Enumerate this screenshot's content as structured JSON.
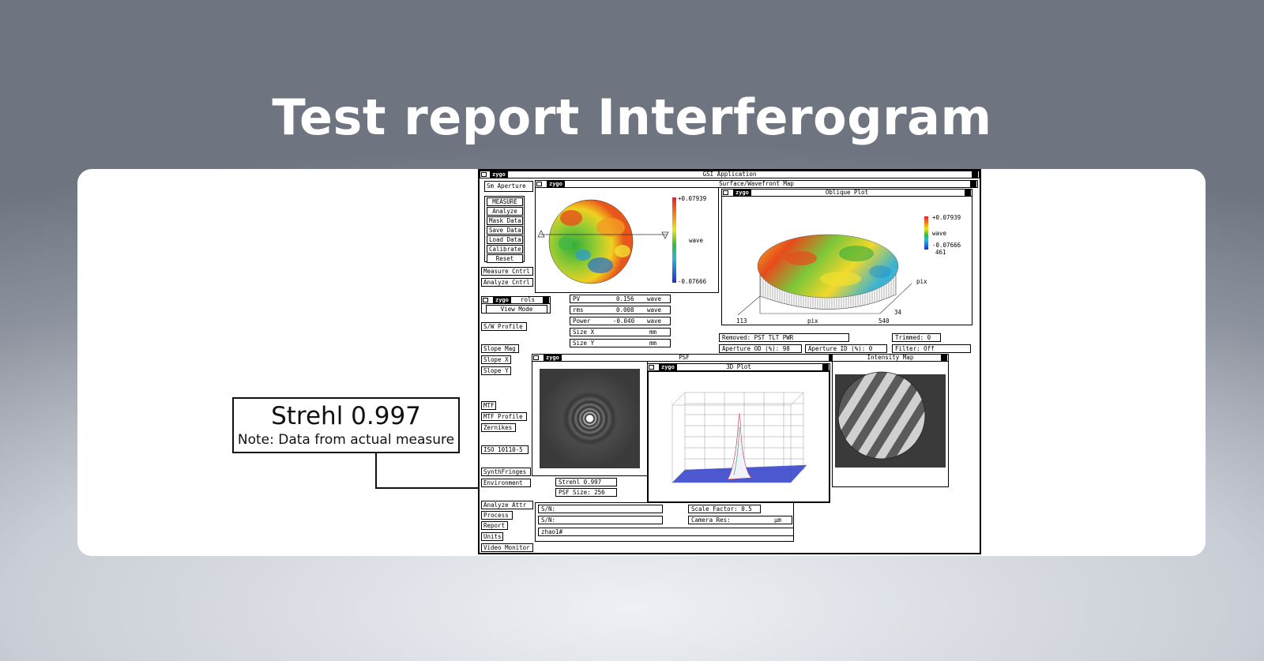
{
  "page": {
    "title": "Test report Interferogram"
  },
  "callout": {
    "strehl_label": "Strehl 0.997",
    "note": "Note: Data from actual measure"
  },
  "app": {
    "title": "GSI Application",
    "logo": "zygo",
    "left_panel": {
      "aperture": "Sm Aperture",
      "buttons": [
        "MEASURE",
        "Analyze",
        "Mask Data",
        "Save Data",
        "Load Data",
        "Calibrate",
        "Reset"
      ],
      "measure_cntrl": "Measure Cntrl",
      "analyze_cntrl": "Analyze Cntrl",
      "controls_title": "rols",
      "view_mode": "View Mode",
      "sw_profile": "S/W Profile",
      "slope_mag": "Slope Mag",
      "slope_x": "Slope X",
      "slope_y": "Slope Y",
      "mtf": "MTF",
      "mtf_profile": "MTF Profile",
      "zernikes": "Zernikes",
      "iso": "ISO 10110-5",
      "synth_fringes": "SynthFringes",
      "environment": "Environment",
      "analyze_attr": "Analyze Attr",
      "process": "Process",
      "report": "Report",
      "units": "Units",
      "video_monitor": "Video Monitor"
    },
    "surface_map": {
      "title": "Surface/Wavefront Map",
      "scale_max": "+0.07939",
      "scale_min": "-0.07666",
      "scale_unit": "wave"
    },
    "stats": [
      {
        "label": "PV",
        "value": "0.156",
        "unit": "wave"
      },
      {
        "label": "rms",
        "value": "0.008",
        "unit": "wave"
      },
      {
        "label": "Power",
        "value": "-0.040",
        "unit": "wave"
      },
      {
        "label": "Size X",
        "value": "",
        "unit": "mm"
      },
      {
        "label": "Size Y",
        "value": "",
        "unit": "mm"
      }
    ],
    "oblique": {
      "title": "Oblique Plot",
      "scale_max": "+0.07939",
      "scale_unit": "wave",
      "scale_min": "-0.07666",
      "y_max": "461",
      "axis_pix_right": "pix",
      "y_min": "34",
      "x_min": "113",
      "x_label": "pix",
      "x_max": "540"
    },
    "settings": {
      "removed": "Removed: PST TLT PWR",
      "trimmed": "Trimmed:   0",
      "aperture_od": "Aperture OD (%):  98",
      "aperture_id": "Aperture ID (%):   0",
      "filter": "Filter:      Off"
    },
    "psf": {
      "title": "PSF",
      "strehl_field": "Strehl    0.997",
      "psf_size": "PSF Size:  256"
    },
    "plot3d": {
      "title": "3D Plot"
    },
    "intensity": {
      "title": "Intensity Map"
    },
    "bottom": {
      "sn1": "S/N:",
      "sn2": "S/N:",
      "scale_factor": "Scale Factor:  0.5",
      "camera_res": "Camera Res:",
      "camera_unit": "µm",
      "prompt": "zhao1#"
    }
  }
}
